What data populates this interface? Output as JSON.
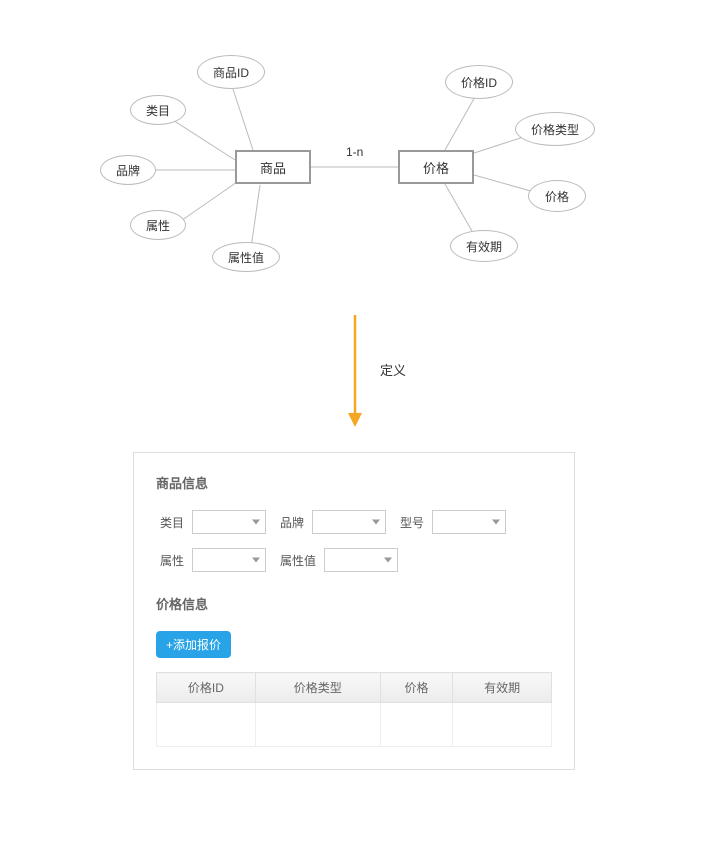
{
  "diagram": {
    "entities": {
      "product": {
        "label": "商品"
      },
      "price": {
        "label": "价格"
      }
    },
    "relation_label": "1-n",
    "product_attrs": {
      "id": "商品ID",
      "cat": "类目",
      "brand": "品牌",
      "attr": "属性",
      "attrv": "属性值"
    },
    "price_attrs": {
      "id": "价格ID",
      "type": "价格类型",
      "price": "价格",
      "valid": "有效期"
    }
  },
  "arrow": {
    "label": "定义"
  },
  "form": {
    "product_info": {
      "title": "商品信息",
      "fields": {
        "category": "类目",
        "brand": "品牌",
        "model": "型号",
        "attr": "属性",
        "attrv": "属性值"
      }
    },
    "price_info": {
      "title": "价格信息",
      "add_button": "+添加报价",
      "columns": {
        "price_id": "价格ID",
        "price_type": "价格类型",
        "price": "价格",
        "valid": "有效期"
      }
    }
  }
}
